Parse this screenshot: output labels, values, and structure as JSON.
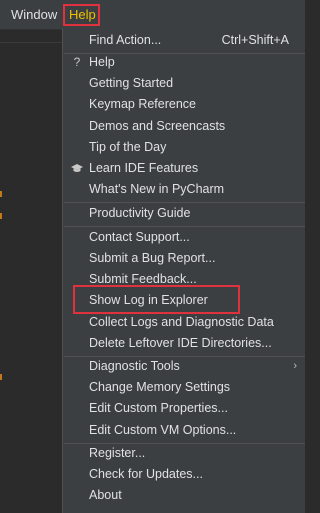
{
  "menubar": {
    "window_label": "Window",
    "help_label": "Help"
  },
  "menu": {
    "find_action": "Find Action...",
    "find_action_shortcut": "Ctrl+Shift+A",
    "help": "Help",
    "getting_started": "Getting Started",
    "keymap_reference": "Keymap Reference",
    "demos_and_screencasts": "Demos and Screencasts",
    "tip_of_the_day": "Tip of the Day",
    "learn_ide_features": "Learn IDE Features",
    "whats_new": "What's New in PyCharm",
    "productivity_guide": "Productivity Guide",
    "contact_support": "Contact Support...",
    "submit_bug_report": "Submit a Bug Report...",
    "submit_feedback": "Submit Feedback...",
    "show_log_in_explorer": "Show Log in Explorer",
    "collect_logs": "Collect Logs and Diagnostic Data",
    "delete_leftover_ide": "Delete Leftover IDE Directories...",
    "diagnostic_tools": "Diagnostic Tools",
    "change_memory_settings": "Change Memory Settings",
    "edit_custom_properties": "Edit Custom Properties...",
    "edit_custom_vm_options": "Edit Custom VM Options...",
    "register": "Register...",
    "check_for_updates": "Check for Updates...",
    "about": "About"
  },
  "icons": {
    "help_icon": "question-mark",
    "learn_icon": "graduation-cap",
    "submenu_arrow": "chevron-right"
  },
  "colors": {
    "menu_bg": "#3c3f41",
    "text": "#dfe1e5",
    "help_accent": "#f0c000",
    "highlight_border": "#e0323e"
  }
}
